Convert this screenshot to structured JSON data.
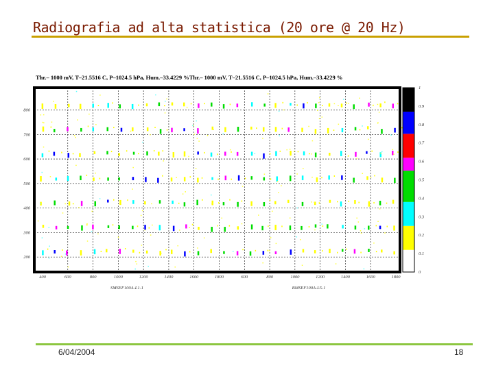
{
  "slide": {
    "title": "Radiografia ad alta statistica (20 ore @ 20 Hz)",
    "footer_date": "6/04/2004",
    "page_number": "18",
    "colors": {
      "title": "#7a1a00",
      "title_rule": "#c9a000",
      "footer_rule": "#8cc63f"
    }
  },
  "chart_data": {
    "type": "heatmap",
    "title": "Thr.– 1000 mV, T–21.5516 C, P–1024.5 hPa, Hum.–33.4229 %Thr.– 1000 mV, T–21.5516 C, P–1024.5 hPa, Hum.–33.4229 %",
    "x_tick_labels": [
      "400",
      "600",
      "800",
      "1000",
      "1200",
      "1400",
      "1600",
      "1800",
      "600",
      "800",
      "1000",
      "1200",
      "1400",
      "1600",
      "1800"
    ],
    "y_tick_labels": [
      "800",
      "700",
      "600",
      "500",
      "400",
      "300",
      "200"
    ],
    "x_sublabels": [
      "SMSEF100A-L1-1",
      "BMSEF100A-L5-1"
    ],
    "colorbar": {
      "ticks": [
        "0",
        "0.1",
        "0.2",
        "0.3",
        "0.4",
        "0.5",
        "0.6",
        "0.7",
        "0.8",
        "0.9",
        "1"
      ],
      "colors": [
        "#ffffff",
        "#ffff00",
        "#00ffff",
        "#00dd00",
        "#ff00ff",
        "#ff0000",
        "#0000ff",
        "#000000"
      ],
      "levels": [
        0,
        0.12,
        0.25,
        0.38,
        0.55,
        0.62,
        0.75,
        0.87,
        1
      ]
    },
    "hit_rows_y": [
      820,
      720,
      620,
      520,
      420,
      320,
      220
    ],
    "hit_columns_per_panel": 14,
    "grid": true,
    "legend": "right"
  }
}
